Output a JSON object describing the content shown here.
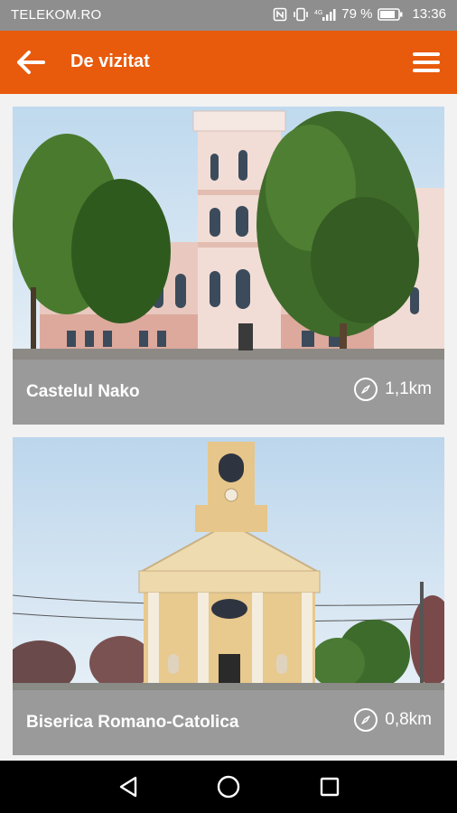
{
  "status_bar": {
    "carrier": "TELEKOM.RO",
    "signal_label": "4G",
    "battery": "79 %",
    "time": "13:36"
  },
  "app_bar": {
    "title": "De vizitat"
  },
  "places": [
    {
      "name": "Castelul Nako",
      "distance": "1,1km"
    },
    {
      "name": "Biserica Romano-Catolica",
      "distance": "0,8km"
    }
  ],
  "colors": {
    "accent": "#e85a0c",
    "card_footer": "#9a9a9a",
    "status_bar": "#8e8e8e",
    "nav_bar": "#000000"
  },
  "icons": {
    "back": "arrow-left-icon",
    "menu": "hamburger-menu-icon",
    "distance": "compass-icon",
    "nav_back": "nav-back-triangle-icon",
    "nav_home": "nav-home-circle-icon",
    "nav_recents": "nav-recents-square-icon"
  }
}
